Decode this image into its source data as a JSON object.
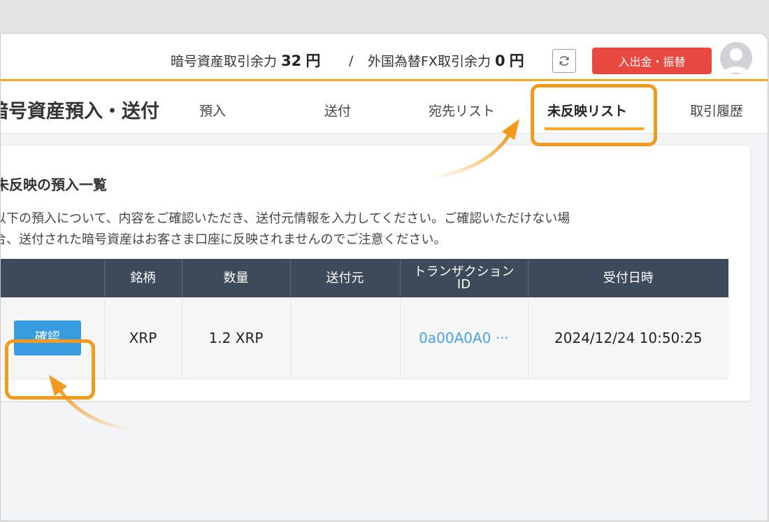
{
  "header": {
    "crypto_balance_label": "暗号資産取引余力",
    "crypto_balance_value": "32",
    "crypto_balance_unit": "円",
    "separator": "/",
    "fx_balance_label": "外国為替FX取引余力",
    "fx_balance_value": "0",
    "fx_balance_unit": "円",
    "deposit_button": "入出金・振替"
  },
  "subnav": {
    "page_title": "暗号資産預入・送付",
    "tabs": [
      {
        "label": "預入"
      },
      {
        "label": "送付"
      },
      {
        "label": "宛先リスト"
      },
      {
        "label": "未反映リスト",
        "active": true
      },
      {
        "label": "取引履歴"
      }
    ]
  },
  "main": {
    "section_title": "未反映の預入一覧",
    "description_line1": "以下の預入について、内容をご確認いただき、送付元情報を入力してください。ご確認いただけない場",
    "description_line2": "合、送付された暗号資産はお客さま口座に反映されませんのでご注意ください。",
    "table": {
      "headers": [
        "",
        "銘柄",
        "数量",
        "送付元",
        "トランザクション",
        "ID",
        "受付日時"
      ],
      "rows": [
        {
          "action": "確認",
          "symbol": "XRP",
          "quantity": "1.2 XRP",
          "source": "",
          "tx_id": "0a00A0A0 ···",
          "received_at": "2024/12/24 10:50:25"
        }
      ]
    }
  },
  "colors": {
    "accent_orange": "#f5a623",
    "highlight_orange": "#f19a1c",
    "deposit_red": "#e8483f",
    "table_header": "#3c4a5a",
    "confirm_blue": "#3a9ce0",
    "link_blue": "#4ba3e3"
  }
}
